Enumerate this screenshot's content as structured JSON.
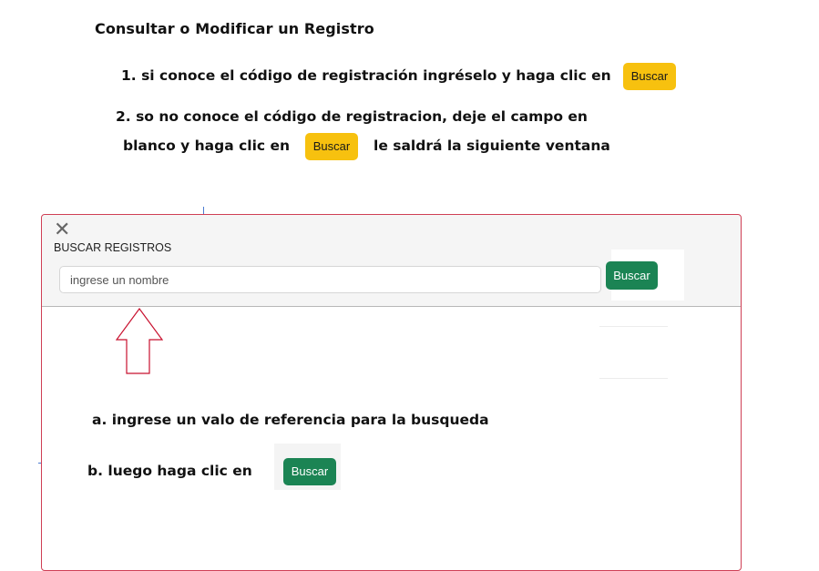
{
  "heading": "Consultar o Modificar un Registro",
  "steps": {
    "step1": "1. si conoce el código de registración ingréselo y haga clic en",
    "step2_line1": "2. so no conoce el código de registracion, deje el campo en",
    "step2_line2_a": "blanco y haga clic en",
    "step2_line2_b": "le saldrá la siguiente ventana"
  },
  "buttons": {
    "buscar": "Buscar"
  },
  "dialog": {
    "close_icon": "close-icon",
    "title": "BUSCAR REGISTROS",
    "search_placeholder": "ingrese un nombre",
    "search_button": "Buscar"
  },
  "annotations": {
    "a": "a. ingrese un valo de referencia para la busqueda",
    "b": "b. luego haga clic en"
  },
  "colors": {
    "yellow_button": "#f7c10f",
    "green_button": "#1b8454",
    "panel_border": "#cf3f55",
    "arrow": "#c8102e"
  }
}
